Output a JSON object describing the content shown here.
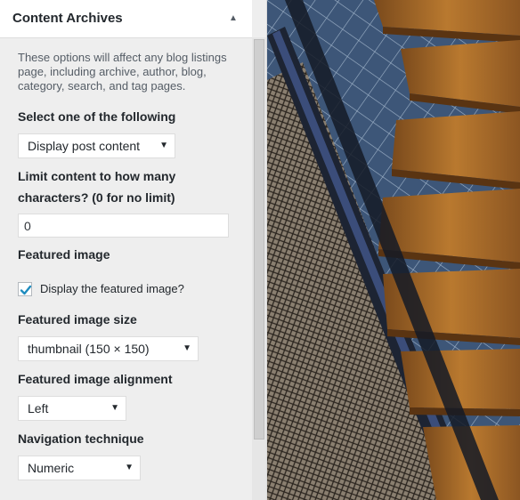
{
  "panel": {
    "title": "Content Archives",
    "description": "These options will affect any blog listings page, including archive, author, blog, category, search, and tag pages.",
    "select_label": "Select one of the following",
    "content_select_value": "Display post content",
    "limit_label_line1": "Limit content to how many",
    "limit_label_line2": "characters? (0 for no limit)",
    "limit_value": "0",
    "featured_image_label": "Featured image",
    "display_featured_label": "Display the featured image?",
    "display_featured_checked": true,
    "featured_size_label": "Featured image size",
    "featured_size_value": "thumbnail (150 × 150)",
    "featured_alignment_label": "Featured image alignment",
    "featured_alignment_value": "Left",
    "navigation_label": "Navigation technique",
    "navigation_value": "Numeric"
  },
  "icons": {
    "collapse": "triangle-up-icon",
    "dropdown": "triangle-down-icon",
    "checkmark": "checkmark-icon"
  },
  "colors": {
    "panel_bg": "#eeeeee",
    "header_bg": "#ffffff",
    "checkmark": "#1e8cbe",
    "text": "#23282d"
  }
}
